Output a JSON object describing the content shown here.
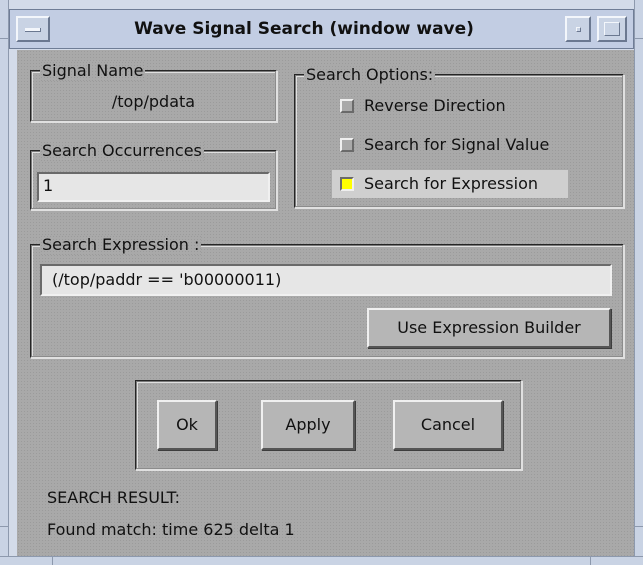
{
  "window": {
    "title": "Wave Signal Search (window wave)"
  },
  "signal_name": {
    "label": "Signal Name",
    "value": "/top/pdata"
  },
  "occurrences": {
    "label": "Search Occurrences",
    "value": "1"
  },
  "options": {
    "label": "Search Options:",
    "items": [
      {
        "label": "Reverse Direction",
        "checked": false
      },
      {
        "label": "Search for Signal Value",
        "checked": false
      },
      {
        "label": "Search for Expression",
        "checked": true
      }
    ]
  },
  "expression": {
    "label": "Search Expression :",
    "value": "(/top/paddr == 'b00000011)",
    "builder_label": "Use Expression Builder"
  },
  "buttons": {
    "ok": "Ok",
    "apply": "Apply",
    "cancel": "Cancel"
  },
  "result": {
    "heading": "SEARCH RESULT:",
    "text": "Found match: time 625 delta 1"
  },
  "colors": {
    "checked": "#ffff00",
    "panel": "#a9a9a9",
    "frame": "#c2cde3"
  }
}
